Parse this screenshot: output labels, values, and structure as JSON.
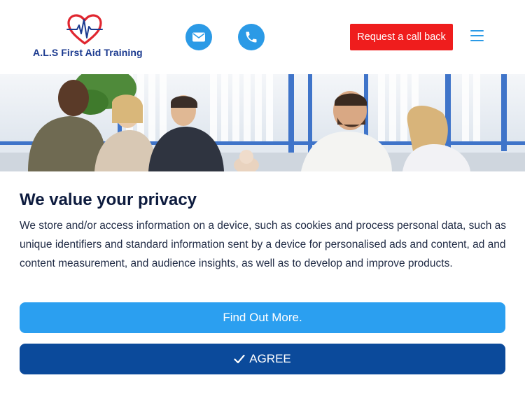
{
  "header": {
    "brand_name": "A.L.S First Aid Training",
    "callback_label": "Request a call back",
    "mail_icon": "mail-icon",
    "phone_icon": "phone-icon",
    "menu_icon": "hamburger-menu-icon",
    "colors": {
      "brand_blue": "#1b3a8f",
      "accent_blue": "#2b9ae6",
      "callback_red": "#ef1d1d",
      "heart_red": "#e0262f"
    }
  },
  "consent": {
    "title": "We value your privacy",
    "body": "We store and/or access information on a device, such as cookies and process personal data, such as unique identifiers and standard information sent by a device for personalised ads and content, ad and content measurement, and audience insights, as well as to develop and improve products.",
    "find_out_more_label": "Find Out More.",
    "agree_label": "AGREE",
    "colors": {
      "find_out_more_bg": "#2b9ff0",
      "agree_bg": "#0b4a9b",
      "title": "#0d1b3e"
    }
  }
}
